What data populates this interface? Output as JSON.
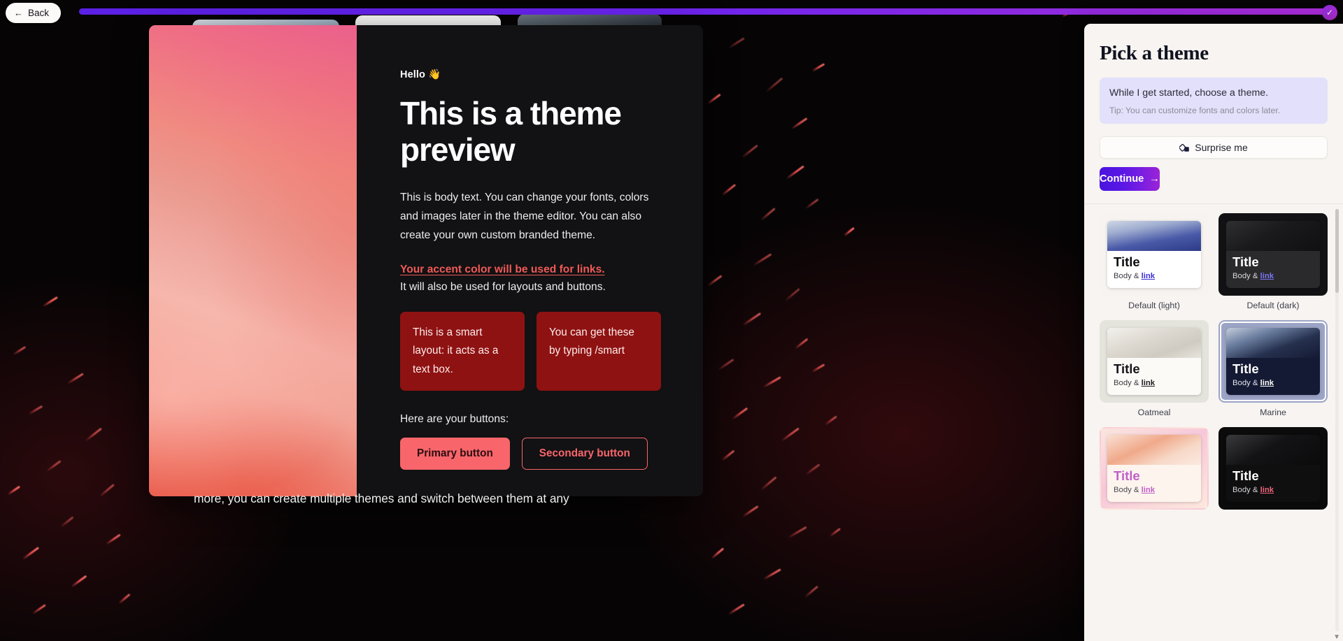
{
  "topbar": {
    "back_label": "Back",
    "back_icon": "arrow-left-icon",
    "progress_percent": 100,
    "progress_color": "#6a23ef",
    "check_icon": "check-circle-icon"
  },
  "preview": {
    "greeting": "Hello 👋",
    "heading": "This is a theme preview",
    "body": "This is body text. You can change your fonts, colors and images later in the theme editor. You can also create your own custom branded theme.",
    "accent_link": "Your accent color will be used for links.",
    "accent_note": "It will also be used for layouts and buttons.",
    "smart_boxes": [
      "This is a smart layout: it acts as a text box.",
      "You can get these by typing /smart"
    ],
    "buttons_label": "Here are your buttons:",
    "primary_button": "Primary button",
    "secondary_button": "Secondary button",
    "accent_color": "#ef5a57",
    "surface_color": "#121113",
    "smart_box_color": "#8e1212"
  },
  "overflow_text": "more, you can create multiple themes and switch between them at any",
  "panel": {
    "title": "Pick a theme",
    "notice_main": "While I get started, choose a theme.",
    "notice_tip": "Tip: You can customize fonts and colors later.",
    "surprise_label": "Surprise me",
    "surprise_icon": "shuffle-dice-icon",
    "continue_label": "Continue",
    "continue_icon": "arrow-right-icon",
    "continue_gradient_start": "#4a14dd",
    "continue_gradient_end": "#9b23d6",
    "themes": [
      {
        "name": "Default (light)",
        "title": "Title",
        "body": "Body & ",
        "link": "link",
        "selected": false
      },
      {
        "name": "Default (dark)",
        "title": "Title",
        "body": "Body & ",
        "link": "link",
        "selected": false
      },
      {
        "name": "Oatmeal",
        "title": "Title",
        "body": "Body & ",
        "link": "link",
        "selected": false
      },
      {
        "name": "Marine",
        "title": "Title",
        "body": "Body & ",
        "link": "link",
        "selected": true
      },
      {
        "name": "",
        "title": "Title",
        "body": "Body & ",
        "link": "link",
        "selected": false
      },
      {
        "name": "",
        "title": "Title",
        "body": "Body & ",
        "link": "link",
        "selected": false
      }
    ]
  }
}
